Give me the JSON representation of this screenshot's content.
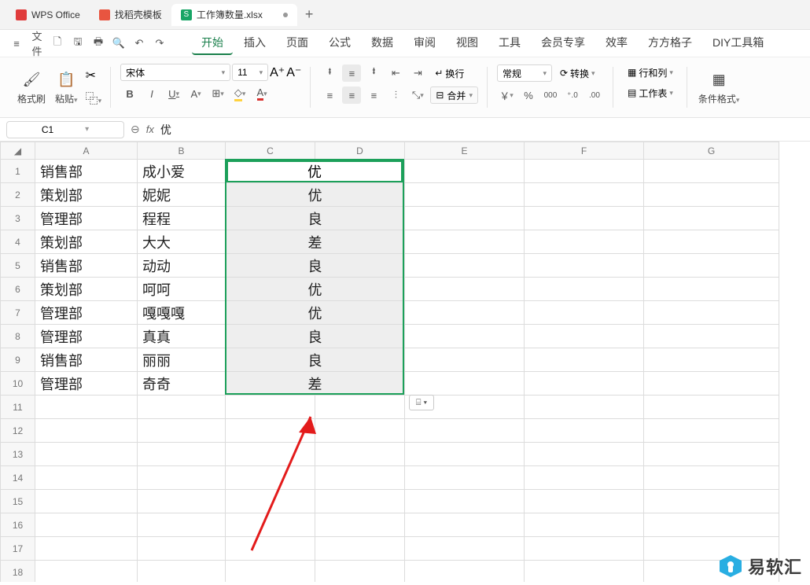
{
  "tabs": {
    "app": "WPS Office",
    "template": "找稻壳模板",
    "doc": "工作簿数量.xlsx",
    "sicon": "S",
    "plus": "+"
  },
  "menubar": {
    "hamburger": "≡",
    "file": "文件",
    "tabs": [
      "开始",
      "插入",
      "页面",
      "公式",
      "数据",
      "审阅",
      "视图",
      "工具",
      "会员专享",
      "效率",
      "方方格子",
      "DIY工具箱"
    ]
  },
  "ribbon": {
    "formatPainter": "格式刷",
    "paste": "粘贴",
    "fontName": "宋体",
    "fontSize": "11",
    "increaseFont": "A⁺",
    "decreaseFont": "A⁻",
    "bold": "B",
    "italic": "I",
    "underline": "U",
    "fontA": "A",
    "wrap": "换行",
    "merge": "合并",
    "numberFormat": "常规",
    "currency": "￥",
    "percent": "%",
    "thousand": "000",
    "decInc": "⁺.0",
    "decDec": ".00",
    "convert": "转换",
    "rowsCols": "行和列",
    "worksheet": "工作表",
    "condFormat": "条件格式"
  },
  "fbar": {
    "cellRef": "C1",
    "fx": "fx",
    "content": "优"
  },
  "grid": {
    "cols": [
      "A",
      "B",
      "C",
      "D",
      "E",
      "F",
      "G"
    ],
    "rows": [
      {
        "n": 1,
        "a": "销售部",
        "b": "成小爱",
        "cd": "优"
      },
      {
        "n": 2,
        "a": "策划部",
        "b": "妮妮",
        "cd": "优"
      },
      {
        "n": 3,
        "a": "管理部",
        "b": "程程",
        "cd": "良"
      },
      {
        "n": 4,
        "a": "策划部",
        "b": "大大",
        "cd": "差"
      },
      {
        "n": 5,
        "a": "销售部",
        "b": "动动",
        "cd": "良"
      },
      {
        "n": 6,
        "a": "策划部",
        "b": "呵呵",
        "cd": "优"
      },
      {
        "n": 7,
        "a": "管理部",
        "b": "嘎嘎嘎",
        "cd": "优"
      },
      {
        "n": 8,
        "a": "管理部",
        "b": "真真",
        "cd": "良"
      },
      {
        "n": 9,
        "a": "销售部",
        "b": "丽丽",
        "cd": "良"
      },
      {
        "n": 10,
        "a": "管理部",
        "b": "奇奇",
        "cd": "差"
      }
    ],
    "emptyRows": [
      11,
      12,
      13,
      14,
      15,
      16,
      17,
      18
    ]
  },
  "pastehint": "⌸ ▾",
  "watermark": "易软汇"
}
